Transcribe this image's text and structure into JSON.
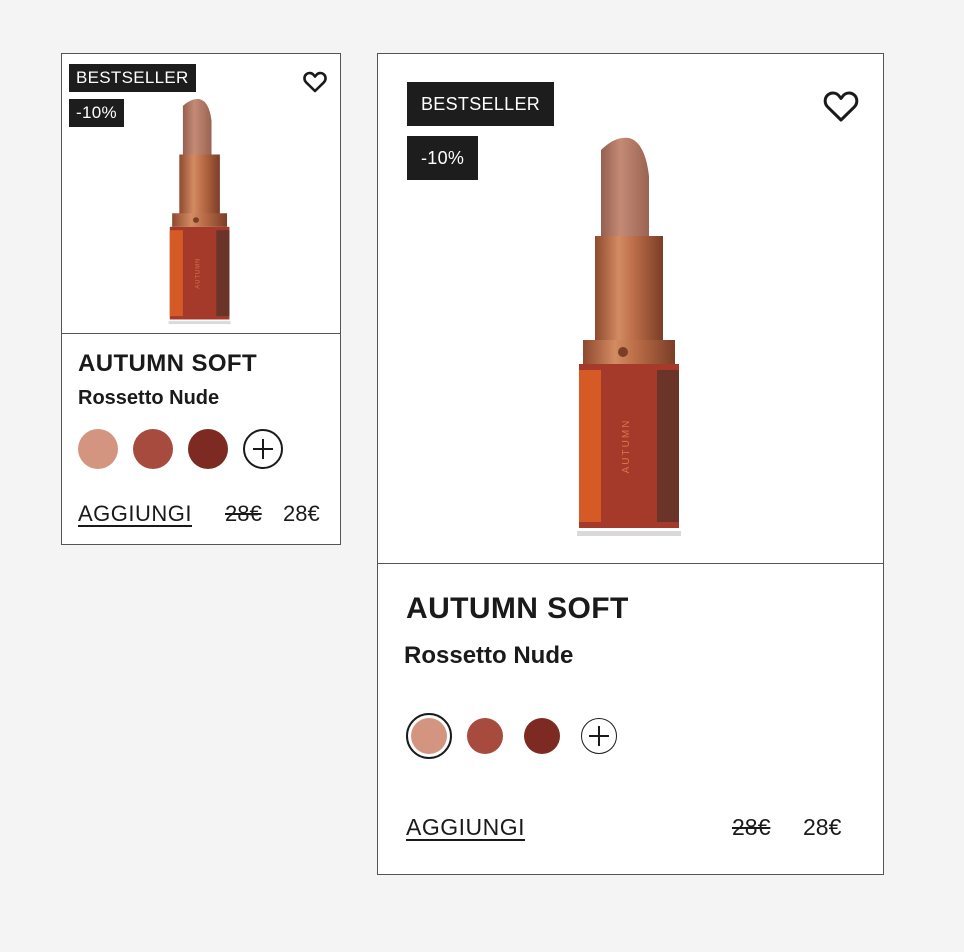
{
  "products": [
    {
      "variant": "small",
      "badges": [
        "BESTSELLER",
        "-10%"
      ],
      "title": "AUTUMN SOFT",
      "subtitle": "Rossetto Nude",
      "product_label": "AUTUMN",
      "swatches": [
        {
          "color": "#d39580",
          "selected": false
        },
        {
          "color": "#a64b3d",
          "selected": false
        },
        {
          "color": "#7c2a22",
          "selected": false
        }
      ],
      "more_swatches_icon": "plus-icon",
      "add_label": "AGGIUNGI",
      "old_price": "28€",
      "new_price": "28€",
      "wishlist_icon": "heart-icon"
    },
    {
      "variant": "large",
      "badges": [
        "BESTSELLER",
        "-10%"
      ],
      "title": "AUTUMN SOFT",
      "subtitle": "Rossetto Nude",
      "product_label": "AUTUMN",
      "swatches": [
        {
          "color": "#d39580",
          "selected": true
        },
        {
          "color": "#a64b3d",
          "selected": false
        },
        {
          "color": "#7c2a22",
          "selected": false
        }
      ],
      "more_swatches_icon": "plus-icon",
      "add_label": "AGGIUNGI",
      "old_price": "28€",
      "new_price": "28€",
      "wishlist_icon": "heart-icon"
    }
  ],
  "colors": {
    "badge_bg": "#1d1d1d",
    "badge_text": "#ffffff",
    "lipstick_bullet": "#b07561",
    "lipstick_metal": "#b86a45",
    "lipstick_case_front": "#a53a2b",
    "lipstick_case_left": "#d65a26",
    "lipstick_case_right": "#6a3428"
  }
}
